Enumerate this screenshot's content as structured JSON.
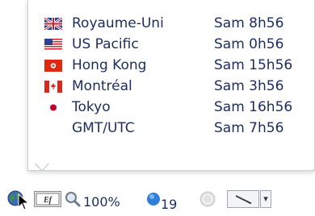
{
  "clocks": [
    {
      "flag": "uk-flag-icon",
      "city": "Royaume-Uni",
      "time": "Sam 8h56"
    },
    {
      "flag": "us-flag-icon",
      "city": "US Pacific",
      "time": "Sam 0h56"
    },
    {
      "flag": "hk-flag-icon",
      "city": "Hong Kong",
      "time": "Sam 15h56"
    },
    {
      "flag": "ca-flag-icon",
      "city": "Montréal",
      "time": "Sam 3h56"
    },
    {
      "flag": "jp-flag-icon",
      "city": "Tokyo",
      "time": "Sam 16h56"
    },
    {
      "flag": "",
      "city": "GMT/UTC",
      "time": "Sam 7h56"
    }
  ],
  "taskbar": {
    "zoom_label": "100%",
    "notification_count": "19",
    "zoom_dropdown_arrow": "▾"
  },
  "colors": {
    "text": "#1b2d5e",
    "popup_border": "#c9cfd6"
  }
}
